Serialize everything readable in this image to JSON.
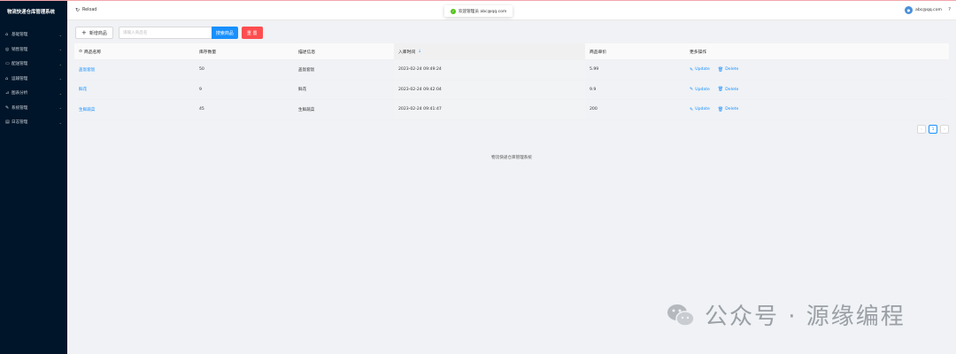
{
  "app": {
    "title": "物流快递仓库管理系统"
  },
  "sidebar": {
    "items": [
      {
        "label": "基础管理",
        "icon": "home-icon"
      },
      {
        "label": "销售管理",
        "icon": "sales-icon"
      },
      {
        "label": "配送管理",
        "icon": "delivery-icon"
      },
      {
        "label": "运输管理",
        "icon": "transport-icon"
      },
      {
        "label": "图表分析",
        "icon": "chart-icon"
      },
      {
        "label": "系统管理",
        "icon": "wrench-icon"
      },
      {
        "label": "日志管理",
        "icon": "log-icon"
      }
    ]
  },
  "header": {
    "reload_label": "Reload",
    "toast_text": "欢迎管理员 abc@qq.com",
    "user_email": "abc@qq.com"
  },
  "toolbar": {
    "add_label": "新增商品",
    "search_placeholder": "请输入商品名",
    "search_label": "搜索商品",
    "reset_label": "重 置"
  },
  "table": {
    "columns": [
      "商品名称",
      "库存数量",
      "描述信息",
      "入库时间",
      "商品单价",
      "更多操作"
    ],
    "rows": [
      {
        "name": "盖饭套饭",
        "qty": "50",
        "desc": "盖饭套饭",
        "time": "2023-02-24 09:49:24",
        "price": "5.99"
      },
      {
        "name": "鲜花",
        "qty": "9",
        "desc": "鲜花",
        "time": "2023-02-24 09:42:04",
        "price": "9.9"
      },
      {
        "name": "生鲜蔬菜",
        "qty": "45",
        "desc": "生鲜蔬菜",
        "time": "2023-02-24 09:41:47",
        "price": "200"
      }
    ],
    "update_label": "Update",
    "delete_label": "Delete"
  },
  "pagination": {
    "prev": "‹",
    "current": "1",
    "next": "›"
  },
  "footer": {
    "text": "物流快递仓库管理系统"
  },
  "watermark": {
    "text": "公众号 · 源缘编程"
  },
  "colors": {
    "sidebar_bg": "#001529",
    "primary": "#1890ff",
    "danger": "#ff4d4f",
    "success": "#52c41a"
  }
}
